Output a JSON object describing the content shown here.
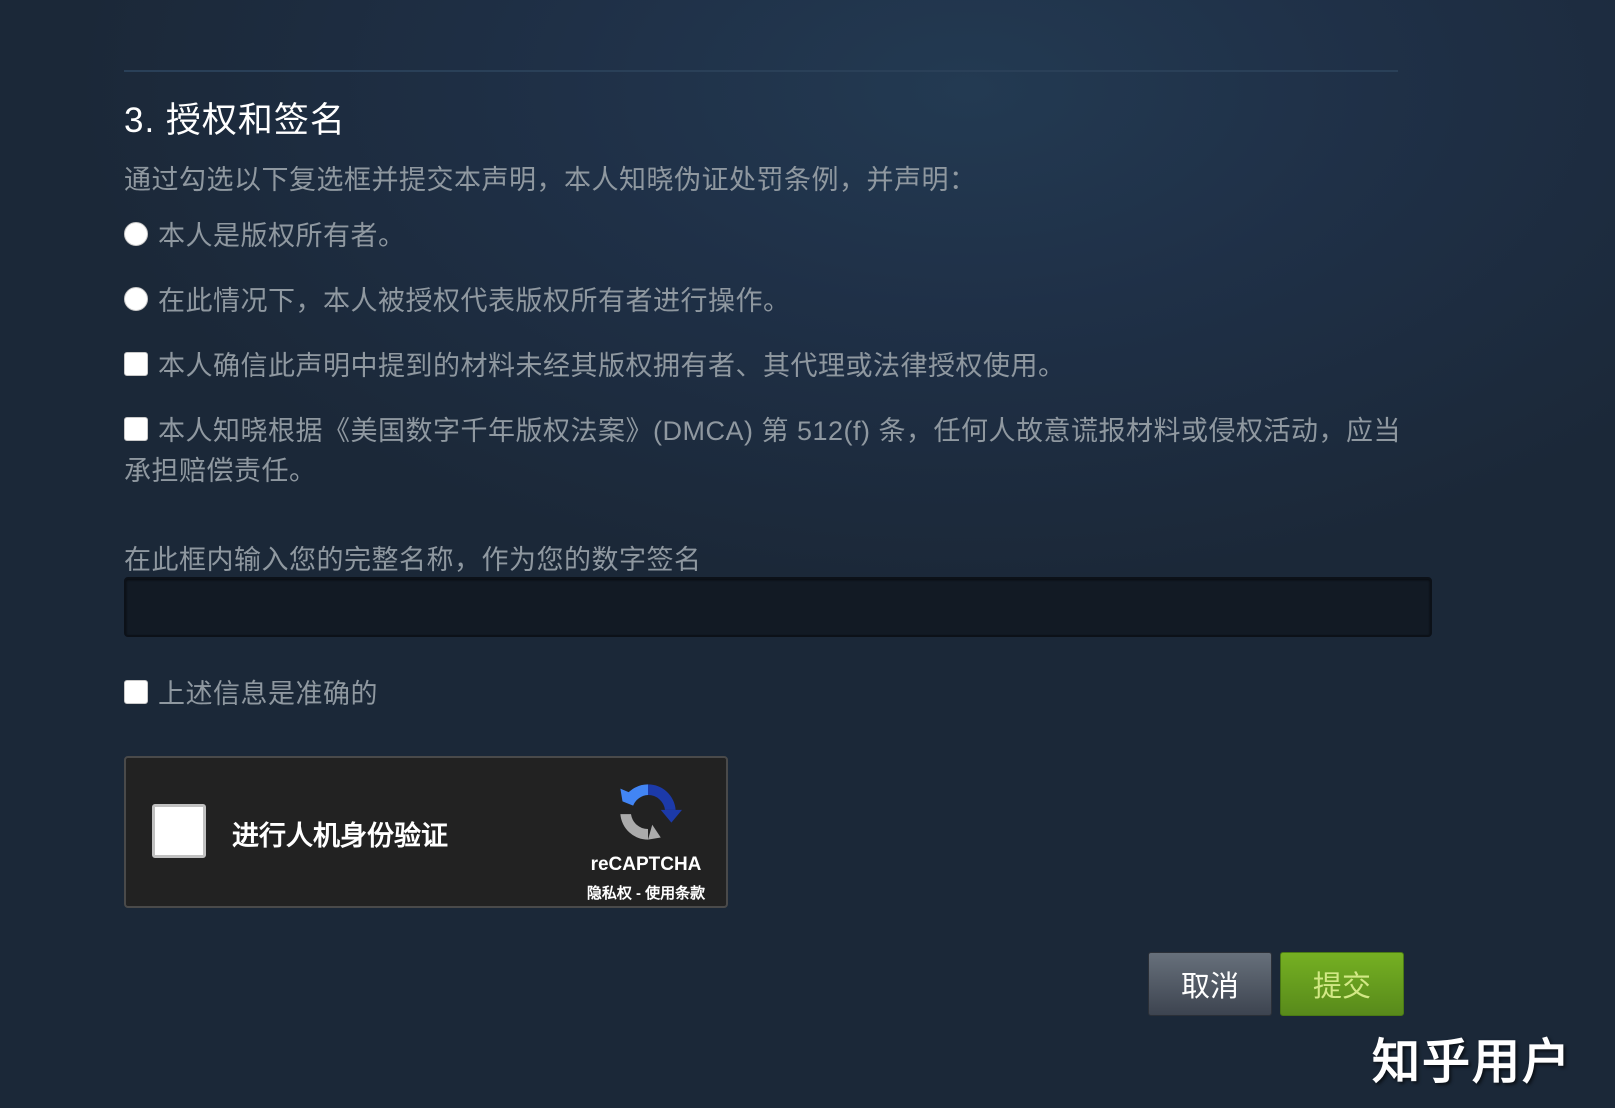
{
  "section": {
    "title": "3. 授权和签名",
    "intro": "通过勾选以下复选框并提交本声明，本人知晓伪证处罚条例，并声明："
  },
  "owner_options": [
    {
      "label": "本人是版权所有者。"
    },
    {
      "label": "在此情况下，本人被授权代表版权所有者进行操作。"
    }
  ],
  "statements": [
    {
      "label": "本人确信此声明中提到的材料未经其版权拥有者、其代理或法律授权使用。"
    },
    {
      "label": "本人知晓根据《美国数字千年版权法案》(DMCA) 第 512(f) 条，任何人故意谎报材料或侵权活动，应当承担赔偿责任。"
    }
  ],
  "signature": {
    "label": "在此框内输入您的完整名称，作为您的数字签名",
    "value": ""
  },
  "accuracy": {
    "label": "上述信息是准确的"
  },
  "recaptcha": {
    "label": "进行人机身份验证",
    "brand": "reCAPTCHA",
    "privacy": "隐私权",
    "separator": " - ",
    "terms": "使用条款"
  },
  "buttons": {
    "cancel": "取消",
    "submit": "提交"
  },
  "watermark": "知乎用户",
  "colors": {
    "background": "#1b2838",
    "submit_green": "#75b022",
    "cancel_gray": "#67707b",
    "text_muted": "#8f98a0"
  }
}
